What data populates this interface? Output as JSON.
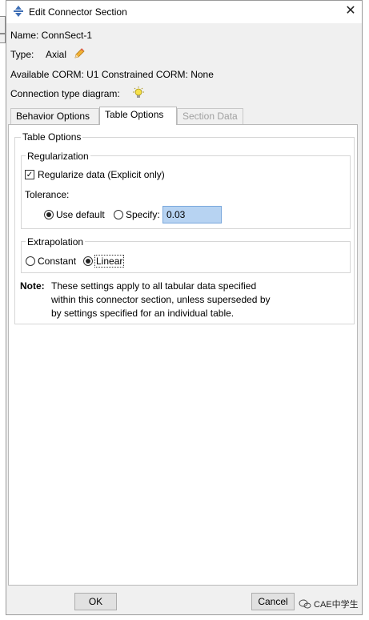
{
  "window": {
    "title": "Edit Connector Section",
    "close_icon": "close-icon",
    "app_icon": "connector-icon"
  },
  "header": {
    "name_line": "Name:  ConnSect-1",
    "type_label": "Type:",
    "type_value": "Axial",
    "corm_line": "Available CORM:  U1  Constrained CORM:  None",
    "diagram_label": "Connection type diagram:"
  },
  "tabs": [
    {
      "label": "Behavior Options",
      "state": "normal"
    },
    {
      "label": "Table Options",
      "state": "active"
    },
    {
      "label": "Section Data",
      "state": "disabled"
    }
  ],
  "table_options": {
    "group_title": "Table Options",
    "regularization": {
      "title": "Regularization",
      "checkbox_label": "Regularize data (Explicit only)",
      "checked": true,
      "tolerance_label": "Tolerance:",
      "use_default_label": "Use default",
      "specify_label": "Specify:",
      "specify_value": "0.03",
      "selected": "Use default"
    },
    "extrapolation": {
      "title": "Extrapolation",
      "constant_label": "Constant",
      "linear_label": "Linear",
      "selected": "Linear"
    },
    "note_label": "Note:",
    "note_lines": [
      "These settings apply to all tabular data specified",
      "within this connector section, unless superseded by",
      "by settings specified for an individual table."
    ]
  },
  "buttons": {
    "ok": "OK",
    "cancel": "Cancel"
  },
  "watermark": "CAE中学生"
}
